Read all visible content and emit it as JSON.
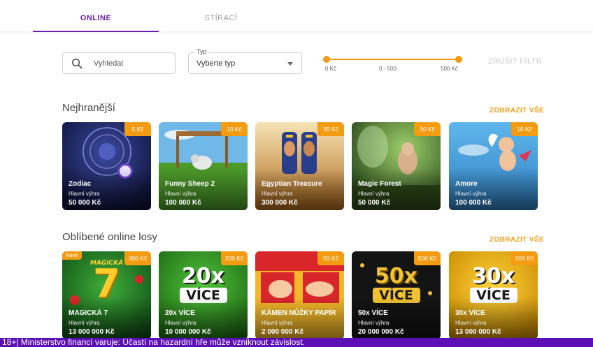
{
  "tabs": [
    {
      "label": "ONLINE",
      "active": true
    },
    {
      "label": "STÍRACÍ",
      "active": false
    }
  ],
  "filters": {
    "search_placeholder": "Vyhledat",
    "type_label": "Typ",
    "type_value": "Vyberte typ",
    "price_min": "0 Kč",
    "price_range": "0 - 500",
    "price_max": "500 Kč",
    "clear_label": "ZRUŠIT FILTR"
  },
  "sections": [
    {
      "title": "Nejhranější",
      "show_all": "ZOBRAZIT VŠE",
      "cards": [
        {
          "name": "Zodiac",
          "sub": "Hlavní výhra",
          "prize": "50 000 Kč",
          "price": "5 Kč"
        },
        {
          "name": "Funny Sheep 2",
          "sub": "Hlavní výhra",
          "prize": "100 000 Kč",
          "price": "10 Kč"
        },
        {
          "name": "Egyptian Treasure",
          "sub": "Hlavní výhra",
          "prize": "300 000 Kč",
          "price": "30 Kč"
        },
        {
          "name": "Magic Forest",
          "sub": "Hlavní výhra",
          "prize": "50 000 Kč",
          "price": "10 Kč"
        },
        {
          "name": "Amore",
          "sub": "Hlavní výhra",
          "prize": "100 000 Kč",
          "price": "10 Kč"
        }
      ]
    },
    {
      "title": "Oblíbené online losy",
      "show_all": "ZOBRAZIT VŠE",
      "cards": [
        {
          "name": "MAGICKÁ 7",
          "sub": "Hlavní výhra",
          "prize": "13 000 000 Kč",
          "price": "300 Kč",
          "badge": "Nové",
          "logo_top": "MAGICKÁ",
          "logo_big": "7"
        },
        {
          "name": "20x VÍCE",
          "sub": "Hlavní výhra",
          "prize": "10 000 000 Kč",
          "price": "200 Kč",
          "logo_top": "20x",
          "logo_big": "VÍCE"
        },
        {
          "name": "KÁMEN NŮŽKY PAPÍR",
          "sub": "Hlavní výhra",
          "prize": "2 000 000 Kč",
          "price": "50 Kč"
        },
        {
          "name": "50x VÍCE",
          "sub": "Hlavní výhra",
          "prize": "20 000 000 Kč",
          "price": "500 Kč",
          "logo_top": "50x",
          "logo_big": "VÍCE"
        },
        {
          "name": "30x VÍCE",
          "sub": "Hlavní výhra",
          "prize": "13 000 000 Kč",
          "price": "300 Kč",
          "logo_top": "30x",
          "logo_big": "VÍCE"
        }
      ]
    }
  ],
  "warning": "18+| Ministerstvo financí varuje: Účastí na hazardní hře může vzniknout závislost.",
  "colors": {
    "accent": "#6b1fb0",
    "orange": "#f39c12",
    "warning_bg": "#5b0fb5"
  }
}
